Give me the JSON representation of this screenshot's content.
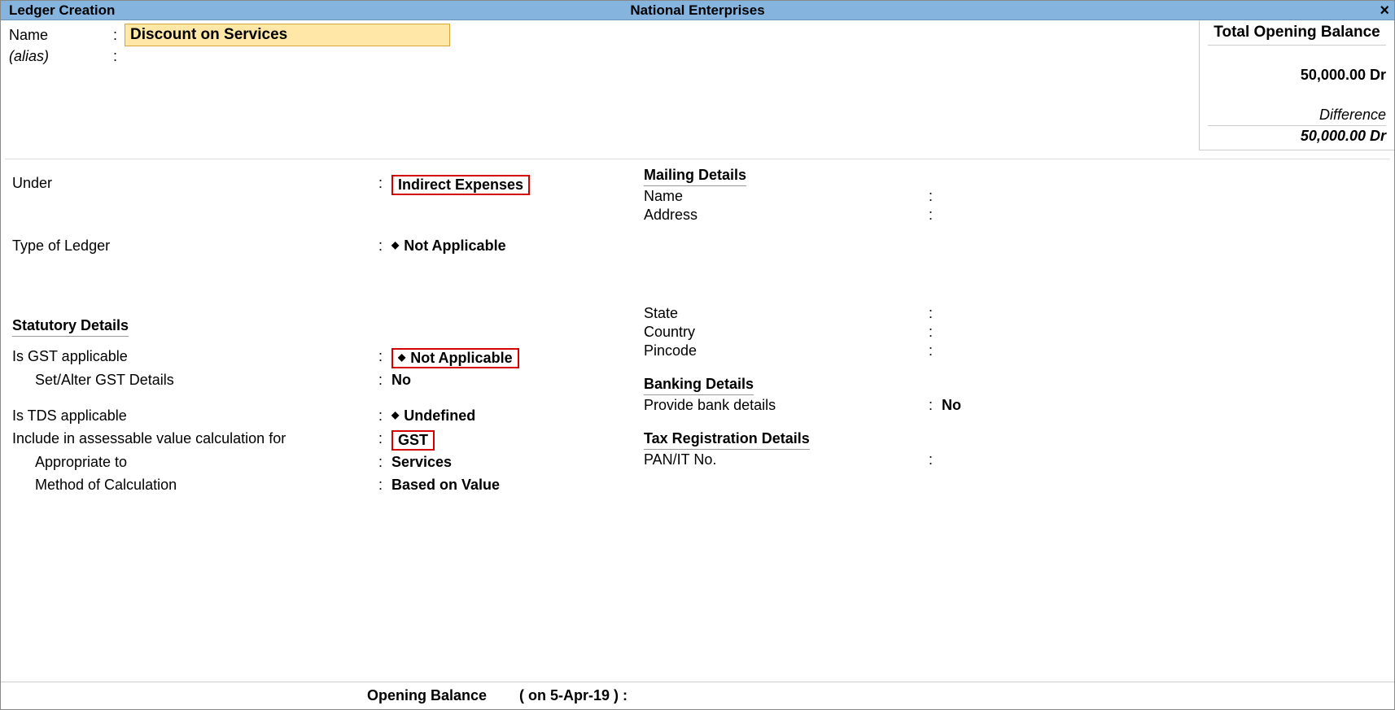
{
  "titlebar": {
    "left": "Ledger Creation",
    "center": "National Enterprises",
    "close": "×"
  },
  "top": {
    "name_label": "Name",
    "name_value": "Discount on Services",
    "alias_label": "(alias)",
    "alias_value": ""
  },
  "balance": {
    "title": "Total Opening Balance",
    "value": "50,000.00 Dr",
    "diff_label": "Difference",
    "diff_value": "50,000.00 Dr"
  },
  "left": {
    "under_label": "Under",
    "under_value": "Indirect Expenses",
    "type_label": "Type of Ledger",
    "type_value": "Not Applicable",
    "stat_head": "Statutory Details",
    "gst_app_label": "Is GST applicable",
    "gst_app_value": "Not Applicable",
    "setalter_label": "Set/Alter GST Details",
    "setalter_value": "No",
    "tds_label": "Is TDS applicable",
    "tds_value": "Undefined",
    "include_label": "Include in assessable value calculation for",
    "include_value": "GST",
    "approp_label": "Appropriate to",
    "approp_value": "Services",
    "method_label": "Method of Calculation",
    "method_value": "Based on Value"
  },
  "right": {
    "mail_head": "Mailing Details",
    "name_label": "Name",
    "name_value": "",
    "addr_label": "Address",
    "addr_value": "",
    "state_label": "State",
    "state_value": "",
    "country_label": "Country",
    "country_value": "",
    "pin_label": "Pincode",
    "pin_value": "",
    "bank_head": "Banking Details",
    "bank_label": "Provide bank details",
    "bank_value": "No",
    "tax_head": "Tax Registration Details",
    "pan_label": "PAN/IT No.",
    "pan_value": ""
  },
  "bottom": {
    "label": "Opening Balance",
    "date": "( on 5-Apr-19 )  :"
  }
}
